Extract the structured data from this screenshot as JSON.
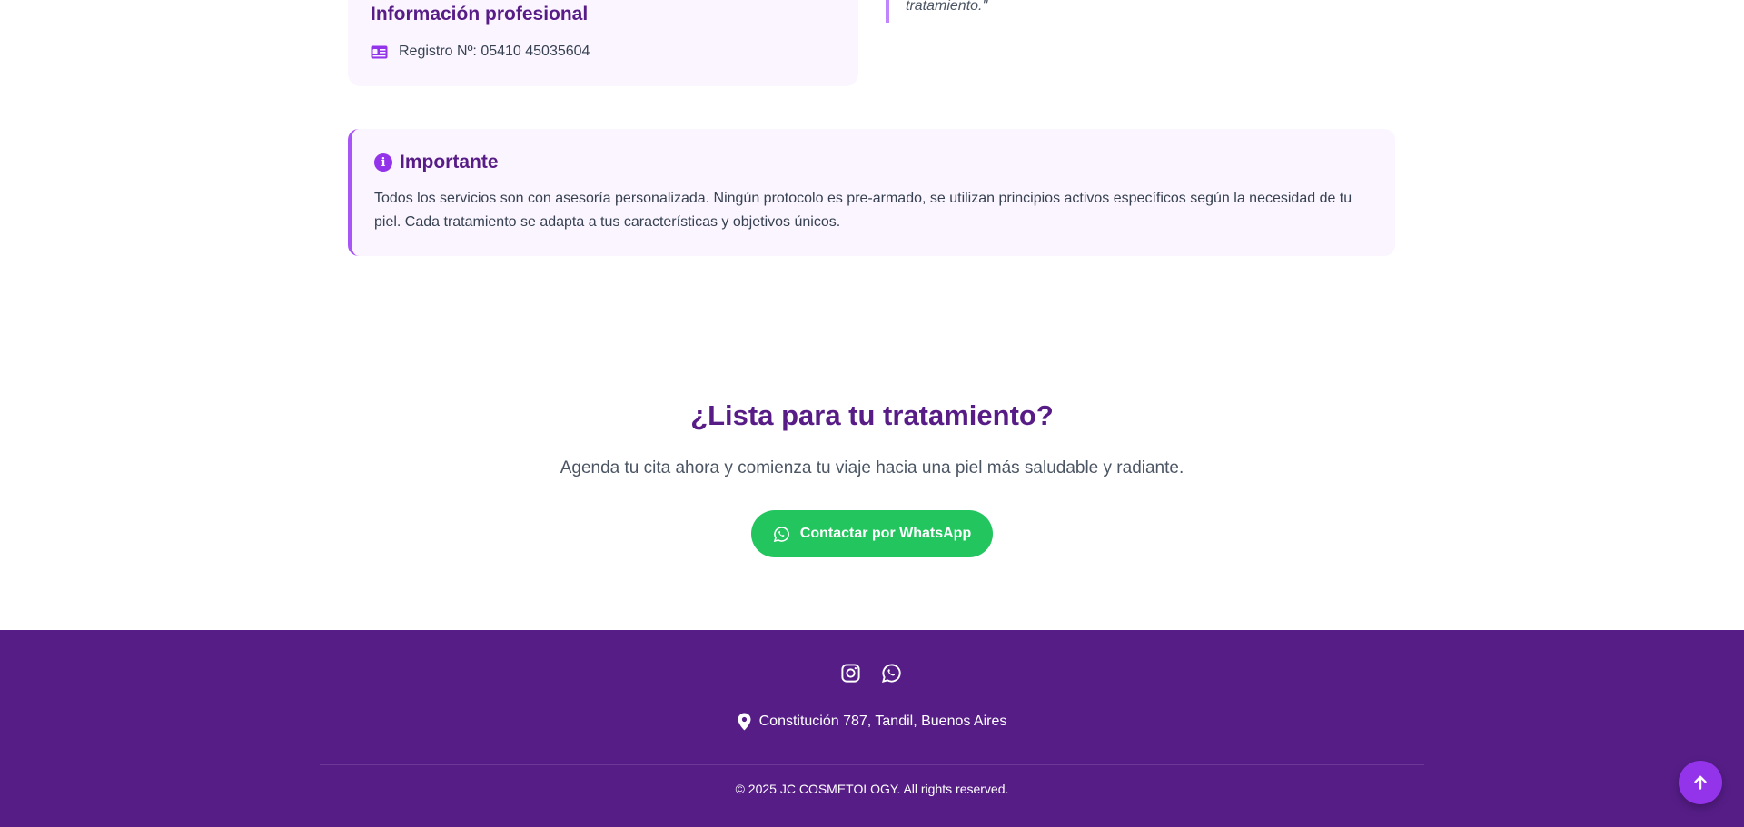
{
  "professional_info": {
    "title": "Información profesional",
    "registry": "Registro Nº: 05410 45035604",
    "icon": "id-card-icon"
  },
  "testimonial": {
    "text_tail": "tratamiento.\""
  },
  "important": {
    "title": "Importante",
    "icon": "info-circle-icon",
    "body": "Todos los servicios son con asesoría personalizada. Ningún protocolo es pre-armado, se utilizan principios activos específicos según la necesidad de tu piel. Cada tratamiento se adapta a tus características y objetivos únicos."
  },
  "cta": {
    "title": "¿Lista para tu tratamiento?",
    "subtitle": "Agenda tu cita ahora y comienza tu viaje hacia una piel más saludable y radiante.",
    "button_label": "Contactar por WhatsApp",
    "button_icon": "whatsapp-icon"
  },
  "footer": {
    "social": [
      "instagram-icon",
      "whatsapp-icon"
    ],
    "address": "Constitución 787, Tandil, Buenos Aires",
    "address_icon": "map-pin-icon",
    "copyright": "© 2025 JC COSMETOLOGY. All rights reserved."
  },
  "scroll_top": {
    "icon": "arrow-up-icon"
  },
  "colors": {
    "brand_purple": "#581c87",
    "footer_bg": "#561d87",
    "accent": "#9333ea",
    "whatsapp_green": "#22c55e",
    "card_bg": "#faf5ff"
  }
}
